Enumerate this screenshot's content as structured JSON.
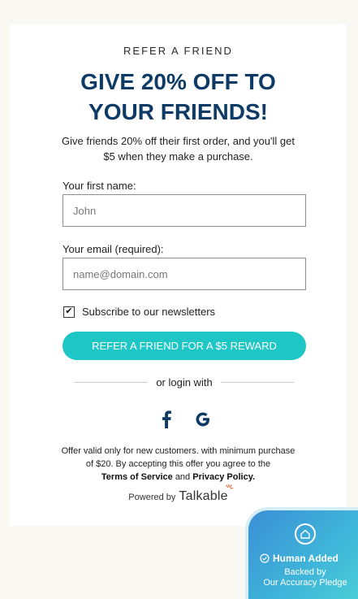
{
  "header": {
    "eyebrow": "REFER A FRIEND",
    "headline": "GIVE 20% OFF TO YOUR FRIENDS!",
    "subtext": "Give friends 20% off their first order, and you'll get $5 when they make a purchase."
  },
  "form": {
    "first_name_label": "Your first name:",
    "first_name_placeholder": "John",
    "email_label": "Your email (required):",
    "email_placeholder": "name@domain.com",
    "newsletter_checked": true,
    "newsletter_label": "Subscribe to our newsletters",
    "submit_label": "REFER A FRIEND FOR A $5 REWARD"
  },
  "login": {
    "divider_text": "or login with",
    "providers": [
      "facebook-icon",
      "google-icon"
    ]
  },
  "terms": {
    "line1": "Offer valid only for new customers. with minimum purchase of $20. By accepting this offer you agree to the",
    "tos_link": "Terms of Service",
    "and": "and",
    "privacy_link": "Privacy Policy."
  },
  "footer": {
    "powered_by": "Powered by",
    "brand": "Talkable"
  },
  "badge": {
    "icon": "home-shield-icon",
    "title": "Human Added",
    "sub_line1": "Backed by",
    "sub_line2": "Our Accuracy Pledge"
  },
  "colors": {
    "headline": "#0d3b66",
    "cta": "#1ec6c6",
    "brand_accent": "#f26b3a",
    "page_bg": "#faf8f2"
  }
}
